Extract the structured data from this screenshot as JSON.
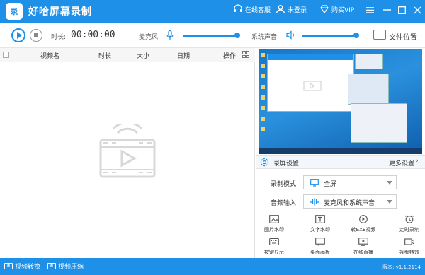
{
  "app": {
    "title": "好哈屏幕录制",
    "logo_text": "录"
  },
  "titlebar": {
    "online_service": "在线客服",
    "not_logged_in": "未登录",
    "buy_vip": "购买VIP"
  },
  "toolbar": {
    "duration_label": "时长:",
    "duration_value": "00:00:00",
    "mic_label": "麦克风:",
    "mic_level": 1.0,
    "system_sound_label": "系统声音:",
    "system_sound_level": 1.0,
    "file_location": "文件位置"
  },
  "list": {
    "columns": [
      "视频名",
      "时长",
      "大小",
      "日期",
      "操作"
    ]
  },
  "settings": {
    "title": "录屏设置",
    "more_settings": "更多设置",
    "record_mode_label": "录制模式",
    "record_mode_value": "全屏",
    "audio_input_label": "音频输入",
    "audio_input_value": "麦克风和系统声音"
  },
  "tools": [
    {
      "label": "图片水印",
      "icon": "image-icon"
    },
    {
      "label": "文字水印",
      "icon": "text-icon"
    },
    {
      "label": "转EXE视频",
      "icon": "exe-play-icon"
    },
    {
      "label": "定时录制",
      "icon": "alarm-clock-icon"
    },
    {
      "label": "按键显示",
      "icon": "keyboard-icon"
    },
    {
      "label": "桌面画板",
      "icon": "whiteboard-icon"
    },
    {
      "label": "在线直播",
      "icon": "live-icon"
    },
    {
      "label": "视频特效",
      "icon": "video-effects-icon"
    }
  ],
  "statusbar": {
    "video_convert": "视频转换",
    "video_compress": "视频压缩",
    "version": "版本: v1.1.2114"
  },
  "colors": {
    "accent": "#1e90e8"
  }
}
